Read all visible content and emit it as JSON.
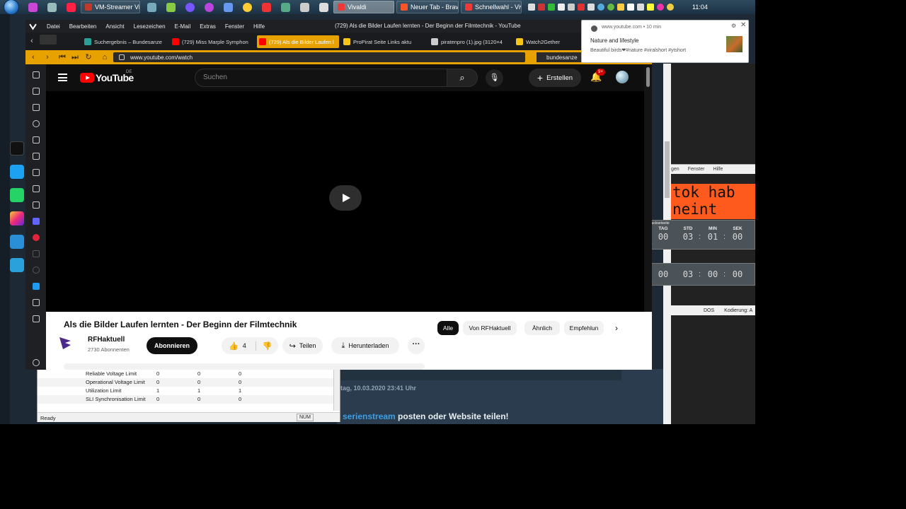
{
  "taskbar": {
    "tasks": [
      {
        "label": "VM-Streamer Vie...",
        "color": "#c0392b",
        "active": false
      },
      {
        "label": "Vivaldi",
        "color": "#ef3939",
        "active": true
      },
      {
        "label": "Neuer Tab - Brave",
        "color": "#fb542b",
        "active": false
      },
      {
        "label": "Schnellwahl - Viv...",
        "color": "#ef3939",
        "active": false
      }
    ],
    "clock": "11:04"
  },
  "browser": {
    "menu": [
      "Datei",
      "Bearbeiten",
      "Ansicht",
      "Lesezeichen",
      "E-Mail",
      "Extras",
      "Fenster",
      "Hilfe"
    ],
    "window_title": "(729) Als die Bilder Laufen lernten - Der Beginn der Filmtechnik - YouTube",
    "tabs": [
      {
        "label": "Suchergebnis – Bundesanze",
        "color": "#2aa198"
      },
      {
        "label": "(729) Miss Marple Symphon",
        "color": "#ff0000"
      },
      {
        "label": "(729) Als die Bilder Laufen l",
        "color": "#ff0000"
      },
      {
        "label": "ProPirat Seite Links aktu",
        "color": "#f5c518"
      },
      {
        "label": "piratenpro (1).jpg (3120×4",
        "color": "#cccccc"
      },
      {
        "label": "Watch2Gether",
        "color": "#f5c518"
      }
    ],
    "url": "www.youtube.com/watch",
    "search_value": "bundesanze"
  },
  "youtube": {
    "logo_text": "YouTube",
    "region": "DE",
    "search_placeholder": "Suchen",
    "create_label": "Erstellen",
    "notification_badge": "9+",
    "video_title": "Als die Bilder Laufen lernten - Der Beginn der Filmtechnik",
    "channel_name": "RFHaktuell",
    "channel_subs": "2730 Abonnenten",
    "subscribe_label": "Abonnieren",
    "like_count": "4",
    "share_label": "Teilen",
    "download_label": "Herunterladen",
    "chips": [
      "Alle",
      "Von RFHaktuell",
      "Ähnlich",
      "Empfehlun"
    ]
  },
  "notification": {
    "source": "www.youtube.com",
    "age": "10 min",
    "title": "Nature and lifestyle",
    "body": "Beautiful birds❤#nature #viralshort #ytshort"
  },
  "right_windows": {
    "menu_items": [
      "gen",
      "Fenster",
      "Hilfe"
    ],
    "mono_lines": [
      "tok hab",
      "neint"
    ],
    "timer1": {
      "name": "Rucksetseite",
      "labels": [
        "TAG",
        "STD",
        "MIN",
        "SEK"
      ],
      "values": [
        "00",
        "03",
        "01",
        "00"
      ]
    },
    "timer2": {
      "values": [
        "00",
        "03",
        "00",
        "00"
      ]
    },
    "status_items": [
      "DOS",
      "Kodierung: A"
    ],
    "date_text": "tag, 10.03.2020 23:41 Uhr",
    "post_link": "serienstream",
    "post_text": " posten oder Website teilen!"
  },
  "voltage_table": {
    "rows": [
      {
        "label": "Reliable Voltage Limit",
        "values": [
          "0",
          "0",
          "0"
        ]
      },
      {
        "label": "Operational Voltage Limit",
        "values": [
          "0",
          "0",
          "0"
        ]
      },
      {
        "label": "Utilization Limit",
        "values": [
          "1",
          "1",
          "1"
        ]
      },
      {
        "label": "SLI Synchronisation Limit",
        "values": [
          "0",
          "0",
          "0"
        ]
      }
    ],
    "status": "Ready",
    "num": "NUM"
  }
}
